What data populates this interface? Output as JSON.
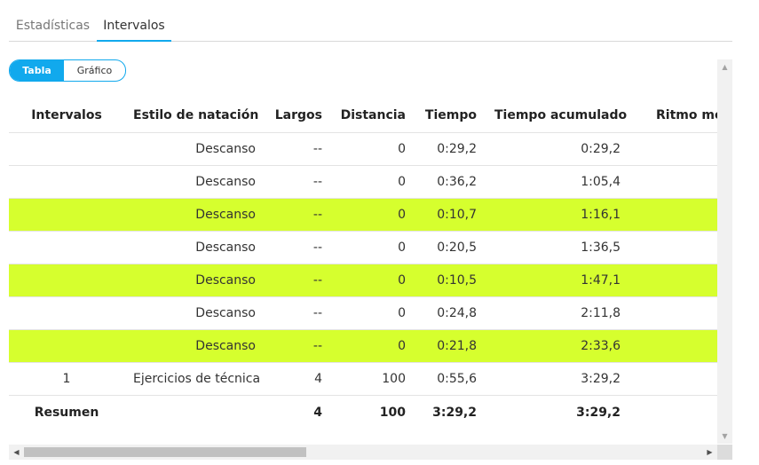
{
  "tabs": [
    {
      "label": "Estadísticas",
      "active": false
    },
    {
      "label": "Intervalos",
      "active": true
    }
  ],
  "view_toggle": {
    "options": [
      "Tabla",
      "Gráfico"
    ],
    "selected": "Tabla"
  },
  "table": {
    "columns": [
      "Intervalos",
      "Estilo de natación",
      "Largos",
      "Distancia",
      "Tiempo",
      "Tiempo acumulado",
      "Ritmo med"
    ],
    "rows": [
      {
        "interval": "",
        "style": "Descanso",
        "lengths": "--",
        "distance": "0",
        "time": "0:29,2",
        "cumulative": "0:29,2",
        "pace": "",
        "highlighted": false
      },
      {
        "interval": "",
        "style": "Descanso",
        "lengths": "--",
        "distance": "0",
        "time": "0:36,2",
        "cumulative": "1:05,4",
        "pace": "",
        "highlighted": false
      },
      {
        "interval": "",
        "style": "Descanso",
        "lengths": "--",
        "distance": "0",
        "time": "0:10,7",
        "cumulative": "1:16,1",
        "pace": "",
        "highlighted": true
      },
      {
        "interval": "",
        "style": "Descanso",
        "lengths": "--",
        "distance": "0",
        "time": "0:20,5",
        "cumulative": "1:36,5",
        "pace": "",
        "highlighted": false
      },
      {
        "interval": "",
        "style": "Descanso",
        "lengths": "--",
        "distance": "0",
        "time": "0:10,5",
        "cumulative": "1:47,1",
        "pace": "",
        "highlighted": true
      },
      {
        "interval": "",
        "style": "Descanso",
        "lengths": "--",
        "distance": "0",
        "time": "0:24,8",
        "cumulative": "2:11,8",
        "pace": "",
        "highlighted": false
      },
      {
        "interval": "",
        "style": "Descanso",
        "lengths": "--",
        "distance": "0",
        "time": "0:21,8",
        "cumulative": "2:33,6",
        "pace": "",
        "highlighted": true
      },
      {
        "interval": "1",
        "style": "Ejercicios de técnica",
        "lengths": "4",
        "distance": "100",
        "time": "0:55,6",
        "cumulative": "3:29,2",
        "pace": "",
        "highlighted": false
      }
    ],
    "summary": {
      "interval": "Resumen",
      "style": "",
      "lengths": "4",
      "distance": "100",
      "time": "3:29,2",
      "cumulative": "3:29,2",
      "pace": ""
    }
  },
  "colors": {
    "accent": "#11a9ed",
    "highlight_row": "#d6ff2e"
  },
  "icons": {
    "scroll_up": "▲",
    "scroll_down": "▼",
    "scroll_left": "◀",
    "scroll_right": "▶"
  }
}
